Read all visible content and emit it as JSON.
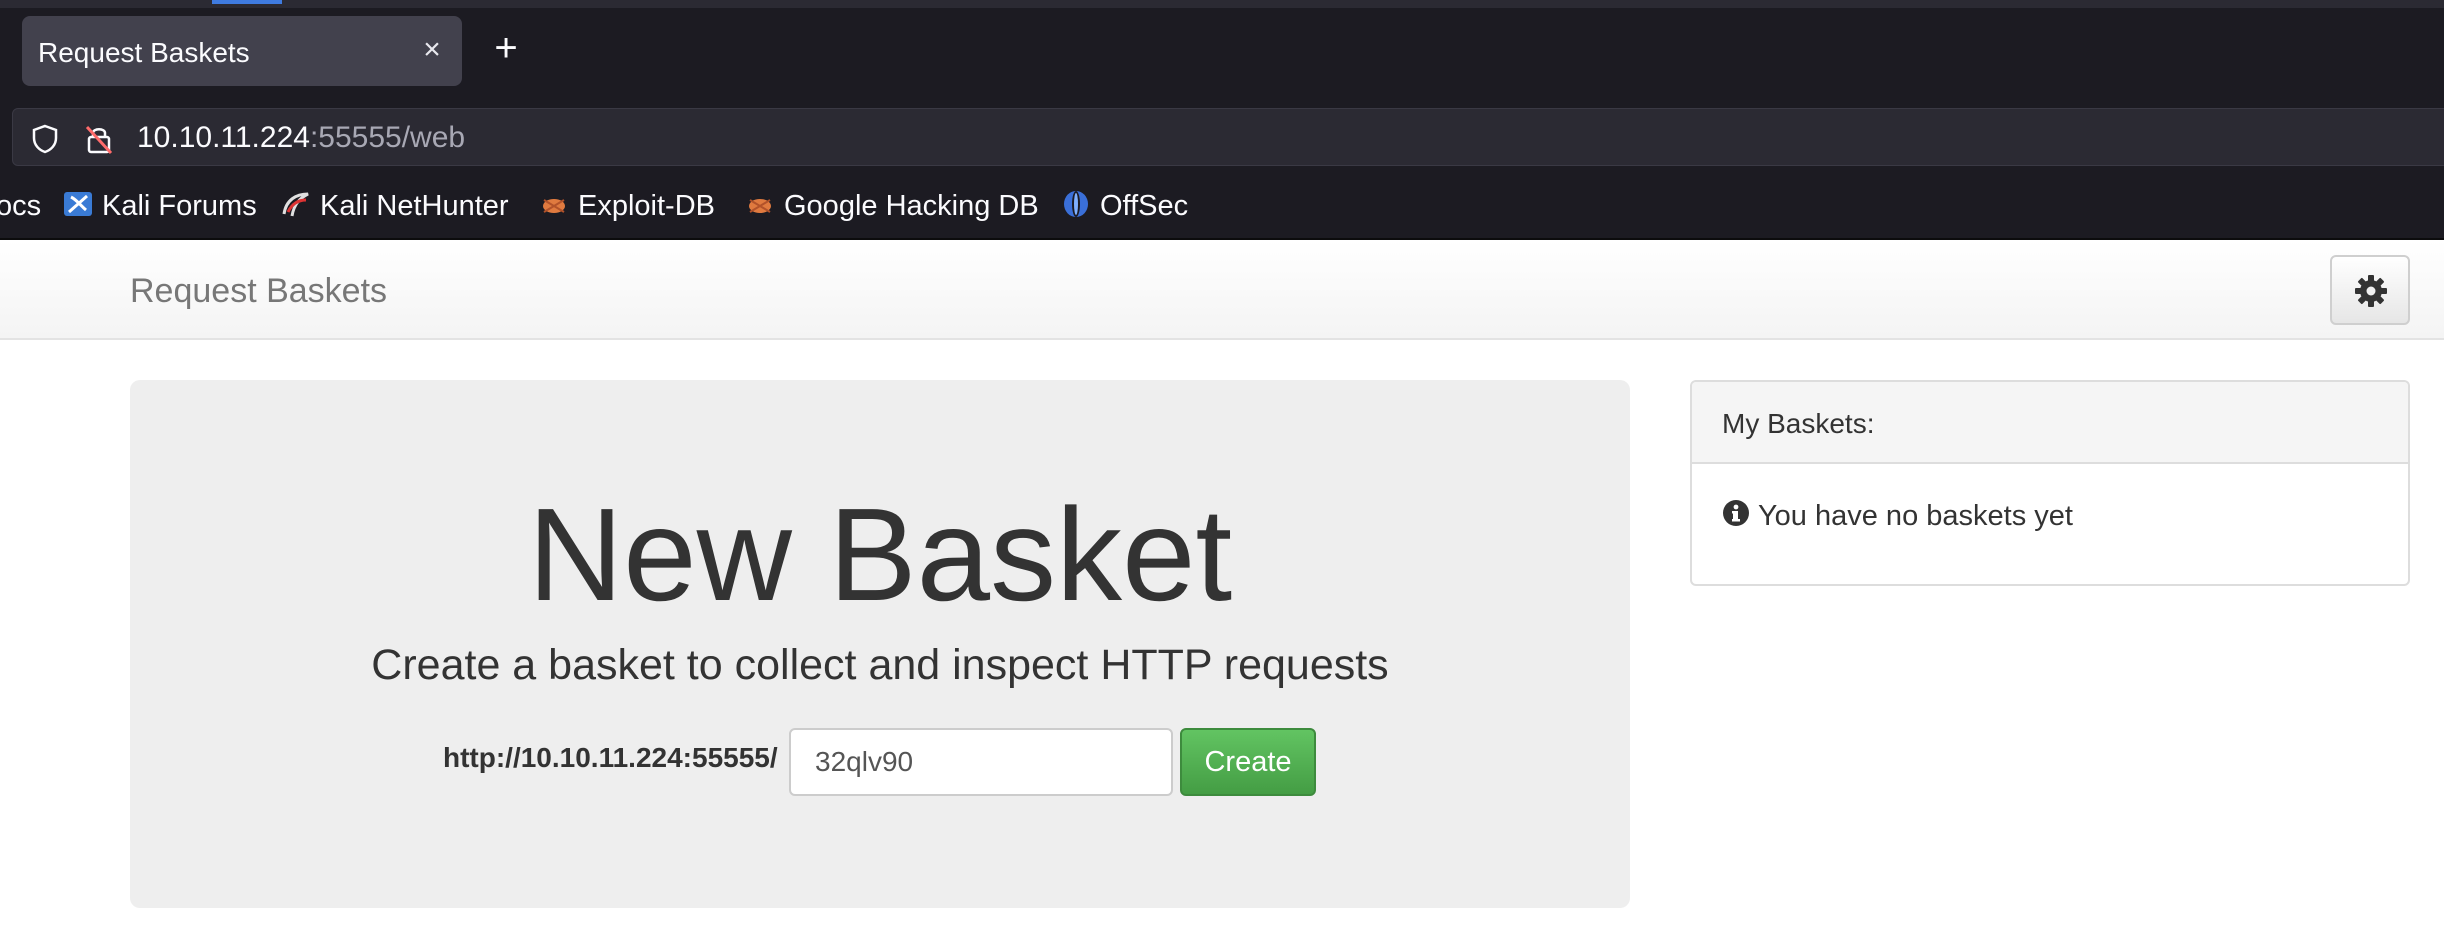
{
  "browser": {
    "tab": {
      "title": "Request Baskets",
      "close_icon": "close-icon"
    },
    "new_tab_icon": "plus-icon",
    "url": {
      "host": "10.10.11.224",
      "rest": ":55555/web"
    },
    "bookmarks": [
      {
        "label": "ocs",
        "icon": ""
      },
      {
        "label": "Kali Forums",
        "icon": "kali-forums-icon"
      },
      {
        "label": "Kali NetHunter",
        "icon": "kali-nethunter-icon"
      },
      {
        "label": "Exploit-DB",
        "icon": "exploit-db-icon"
      },
      {
        "label": "Google Hacking DB",
        "icon": "google-hacking-db-icon"
      },
      {
        "label": "OffSec",
        "icon": "offsec-icon"
      }
    ]
  },
  "navbar": {
    "brand": "Request Baskets",
    "settings_icon": "gear-icon"
  },
  "jumbotron": {
    "title": "New Basket",
    "subtitle": "Create a basket to collect and inspect HTTP requests",
    "url_prefix": "http://10.10.11.224:55555/",
    "basket_name_value": "32qlv90",
    "create_label": "Create"
  },
  "panel": {
    "title": "My Baskets:",
    "empty_message": "You have no baskets yet",
    "info_icon": "info-circle-icon"
  },
  "colors": {
    "chrome_bg": "#1c1b22",
    "tab_bg": "#42414d",
    "urlbar_bg": "#2b2a33",
    "create_green": "#5cb85c",
    "jumbotron_bg": "#eeeeee"
  }
}
